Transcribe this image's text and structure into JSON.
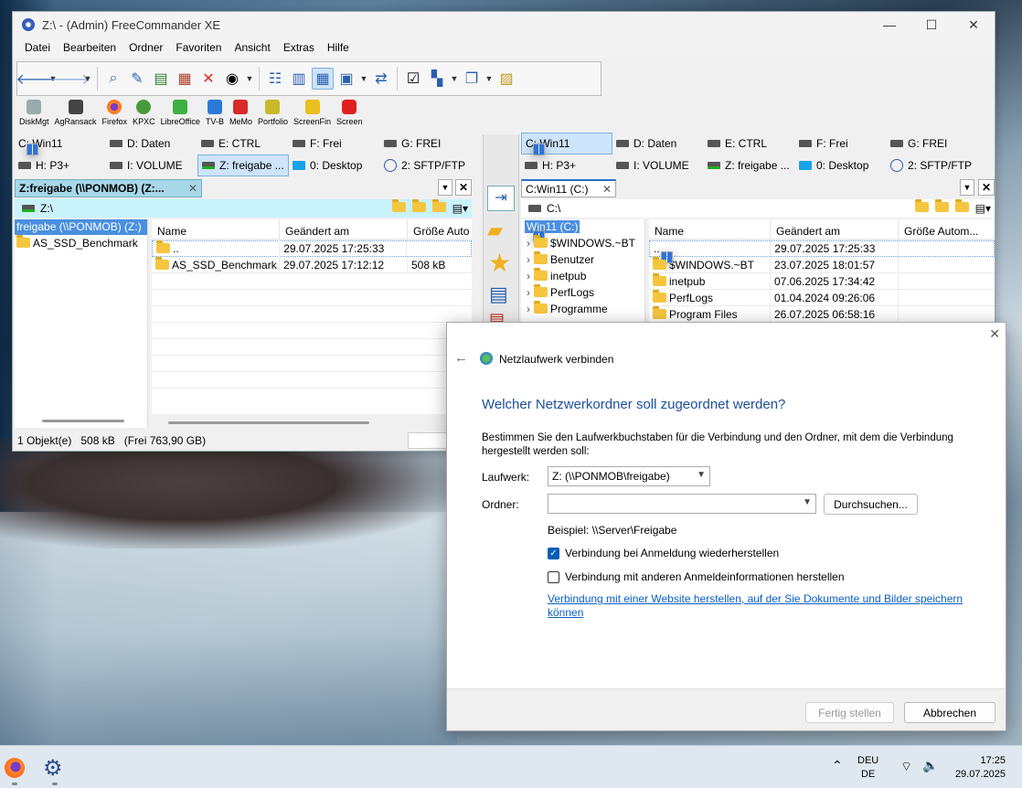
{
  "window": {
    "title": "Z:\\ - (Admin) FreeCommander XE",
    "controls": {
      "minimize": "—",
      "maximize": "☐",
      "close": "✕"
    }
  },
  "menu": [
    "Datei",
    "Bearbeiten",
    "Ordner",
    "Favoriten",
    "Ansicht",
    "Extras",
    "Hilfe"
  ],
  "launchbar": [
    "DiskMgt",
    "AgRansack",
    "Firefox",
    "KPXC",
    "LibreOffice",
    "TV-B",
    "MeMo",
    "Portfolio",
    "ScreenFin",
    "Screen"
  ],
  "drives_left": [
    {
      "label": "C: Win11",
      "icon": "windows-drive-icon"
    },
    {
      "label": "D: Daten",
      "icon": "drive-icon"
    },
    {
      "label": "E: CTRL",
      "icon": "drive-icon"
    },
    {
      "label": "F: Frei",
      "icon": "drive-icon"
    },
    {
      "label": "G: FREI",
      "icon": "drive-icon"
    },
    {
      "label": "H: P3+",
      "icon": "drive-icon"
    },
    {
      "label": "I: VOLUME",
      "icon": "drive-icon"
    },
    {
      "label": "Z: freigabe ...",
      "icon": "network-drive-icon",
      "selected": true
    },
    {
      "label": "0: Desktop",
      "icon": "desktop-icon"
    },
    {
      "label": "2: SFTP/FTP",
      "icon": "globe-icon"
    }
  ],
  "drives_right": [
    {
      "label": "C: Win11",
      "icon": "windows-drive-icon",
      "selected": true
    },
    {
      "label": "D: Daten",
      "icon": "drive-icon"
    },
    {
      "label": "E: CTRL",
      "icon": "drive-icon"
    },
    {
      "label": "F: Frei",
      "icon": "drive-icon"
    },
    {
      "label": "G: FREI",
      "icon": "drive-icon"
    },
    {
      "label": "H: P3+",
      "icon": "drive-icon"
    },
    {
      "label": "I: VOLUME",
      "icon": "drive-icon"
    },
    {
      "label": "Z: freigabe ...",
      "icon": "network-drive-icon"
    },
    {
      "label": "0: Desktop",
      "icon": "desktop-icon"
    },
    {
      "label": "2: SFTP/FTP",
      "icon": "globe-icon"
    }
  ],
  "left_panel": {
    "tab": "Z:freigabe (\\\\PONMOB) (Z:...",
    "path": "Z:\\",
    "tree_root": "freigabe (\\\\PONMOB) (Z:)",
    "tree_items": [
      "AS_SSD_Benchmark"
    ],
    "columns": [
      "Name",
      "Geändert am",
      "Größe Auto"
    ],
    "rows": [
      {
        "name": "..",
        "date": "29.07.2025 17:25:33",
        "size": ""
      },
      {
        "name": "AS_SSD_Benchmark",
        "date": "29.07.2025 17:12:12",
        "size": "508 kB"
      }
    ],
    "status": {
      "objects": "1 Objekt(e)",
      "size": "508 kB",
      "free": "(Frei 763,90 GB)"
    }
  },
  "right_panel": {
    "tab": "C:Win11 (C:)",
    "path": "C:\\",
    "tree_root": "Win11 (C:)",
    "tree_items": [
      "$WINDOWS.~BT",
      "Benutzer",
      "inetpub",
      "PerfLogs",
      "Programme"
    ],
    "columns": [
      "Name",
      "Geändert am",
      "Größe Autom..."
    ],
    "rows": [
      {
        "name": "..",
        "date": "29.07.2025 17:25:33"
      },
      {
        "name": "$WINDOWS.~BT",
        "date": "23.07.2025 18:01:57"
      },
      {
        "name": "inetpub",
        "date": "07.06.2025 17:34:42"
      },
      {
        "name": "PerfLogs",
        "date": "01.04.2024 09:26:06"
      },
      {
        "name": "Program Files",
        "date": "26.07.2025 06:58:16"
      }
    ]
  },
  "dialog": {
    "title": "Netzlaufwerk verbinden",
    "heading": "Welcher Netzwerkordner soll zugeordnet werden?",
    "description": "Bestimmen Sie den Laufwerkbuchstaben für die Verbindung und den Ordner, mit dem die Verbindung hergestellt werden soll:",
    "drive_label": "Laufwerk:",
    "drive_value": "Z: (\\\\PONMOB\\freigabe)",
    "folder_label": "Ordner:",
    "folder_value": "",
    "browse": "Durchsuchen...",
    "example": "Beispiel: \\\\Server\\Freigabe",
    "reconnect": {
      "label": "Verbindung bei Anmeldung wiederherstellen",
      "checked": true
    },
    "other_creds": {
      "label": "Verbindung mit anderen Anmeldeinformationen herstellen",
      "checked": false
    },
    "link": "Verbindung mit einer Website herstellen, auf der Sie Dokumente und Bilder speichern können",
    "finish": "Fertig stellen",
    "cancel": "Abbrechen",
    "close": "✕",
    "back": "←"
  },
  "taskbar": {
    "lang": "DEU",
    "region": "DE",
    "time": "17:25",
    "date": "29.07.2025"
  }
}
